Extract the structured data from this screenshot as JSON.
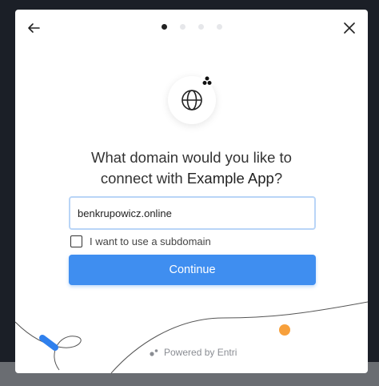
{
  "header": {
    "steps": 4,
    "active_step": 1
  },
  "main": {
    "question_prefix": "What domain would you like to",
    "question_mid": "connect with ",
    "app_name": "Example App",
    "question_suffix": "?",
    "domain_value": "benkrupowicz.online",
    "subdomain_label": "I want to use a subdomain",
    "subdomain_checked": false,
    "continue_label": "Continue"
  },
  "footer": {
    "powered_by": "Powered by Entri"
  },
  "colors": {
    "accent": "#3f8ef0",
    "input_border": "#b9d5f7",
    "decor_blue": "#2f80ed",
    "decor_orange": "#f7a03c"
  },
  "icons": {
    "back": "arrow-left-icon",
    "close": "close-icon",
    "globe": "globe-icon",
    "app_badge": "app-logo-icon",
    "entri": "entri-logo-icon"
  }
}
